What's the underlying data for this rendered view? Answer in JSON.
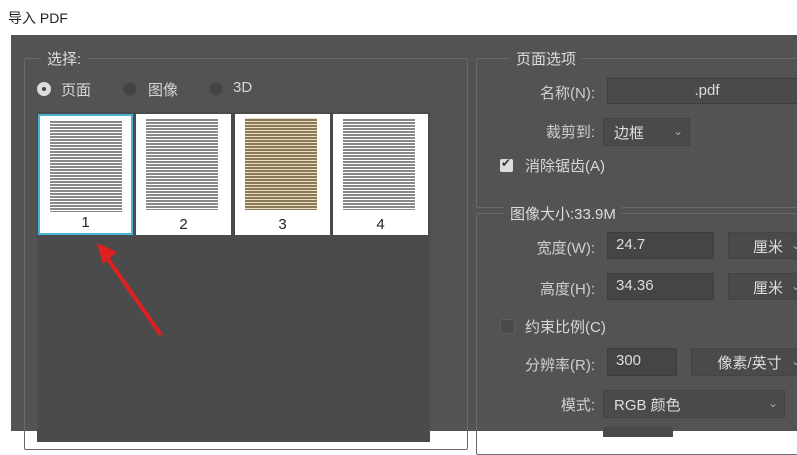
{
  "window": {
    "title": "导入 PDF"
  },
  "select_group": {
    "label": "选择:",
    "options": [
      {
        "label": "页面",
        "selected": true
      },
      {
        "label": "图像",
        "selected": false
      },
      {
        "label": "3D",
        "selected": false
      }
    ],
    "thumbnails": [
      {
        "label": "1",
        "selected": true
      },
      {
        "label": "2",
        "selected": false
      },
      {
        "label": "3",
        "selected": false
      },
      {
        "label": "4",
        "selected": false
      }
    ]
  },
  "page_options": {
    "label": "页面选项",
    "name_label": "名称(N):",
    "name_value": ".pdf",
    "crop_label": "裁剪到:",
    "crop_value": "边框",
    "antialias_label": "消除锯齿(A)",
    "antialias_checked": true
  },
  "image_size": {
    "label": "图像大小:33.9M",
    "width_label": "宽度(W):",
    "width_value": "24.7",
    "width_unit": "厘米",
    "height_label": "高度(H):",
    "height_value": "34.36",
    "height_unit": "厘米",
    "constrain_label": "约束比例(C)",
    "constrain_checked": false,
    "resolution_label": "分辨率(R):",
    "resolution_value": "300",
    "resolution_unit": "像素/英寸",
    "mode_label": "模式:",
    "mode_value": "RGB 颜色"
  },
  "colors": {
    "panel": "#535353",
    "selection": "#4bb4d6",
    "arrow": "#e02020"
  }
}
